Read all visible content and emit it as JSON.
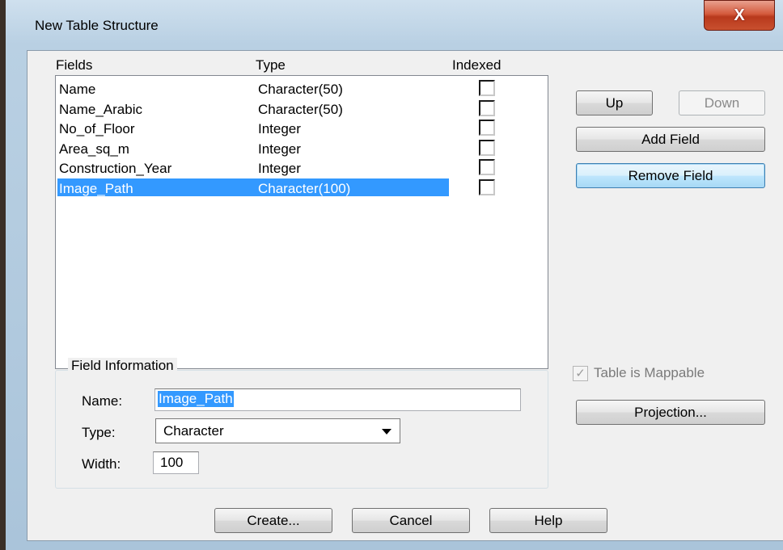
{
  "window": {
    "title": "New Table Structure",
    "close_glyph": "X"
  },
  "headers": {
    "fields": "Fields",
    "type": "Type",
    "indexed": "Indexed"
  },
  "fields": [
    {
      "name": "Name",
      "type": "Character(50)",
      "indexed": false,
      "selected": false
    },
    {
      "name": "Name_Arabic",
      "type": "Character(50)",
      "indexed": false,
      "selected": false
    },
    {
      "name": "No_of_Floor",
      "type": "Integer",
      "indexed": false,
      "selected": false
    },
    {
      "name": "Area_sq_m",
      "type": "Integer",
      "indexed": false,
      "selected": false
    },
    {
      "name": "Construction_Year",
      "type": "Integer",
      "indexed": false,
      "selected": false
    },
    {
      "name": "Image_Path",
      "type": "Character(100)",
      "indexed": false,
      "selected": true
    }
  ],
  "buttons": {
    "up": "Up",
    "down": "Down",
    "add_field": "Add Field",
    "remove_field": "Remove Field",
    "projection": "Projection...",
    "create": "Create...",
    "cancel": "Cancel",
    "help": "Help"
  },
  "field_info": {
    "group_label": "Field Information",
    "name_label": "Name:",
    "name_value": "Image_Path",
    "type_label": "Type:",
    "type_value": "Character",
    "width_label": "Width:",
    "width_value": "100"
  },
  "mappable": {
    "label": "Table is Mappable",
    "checked": true,
    "enabled": false
  },
  "colors": {
    "selection": "#3399ff",
    "close_button": "#c8502f"
  }
}
